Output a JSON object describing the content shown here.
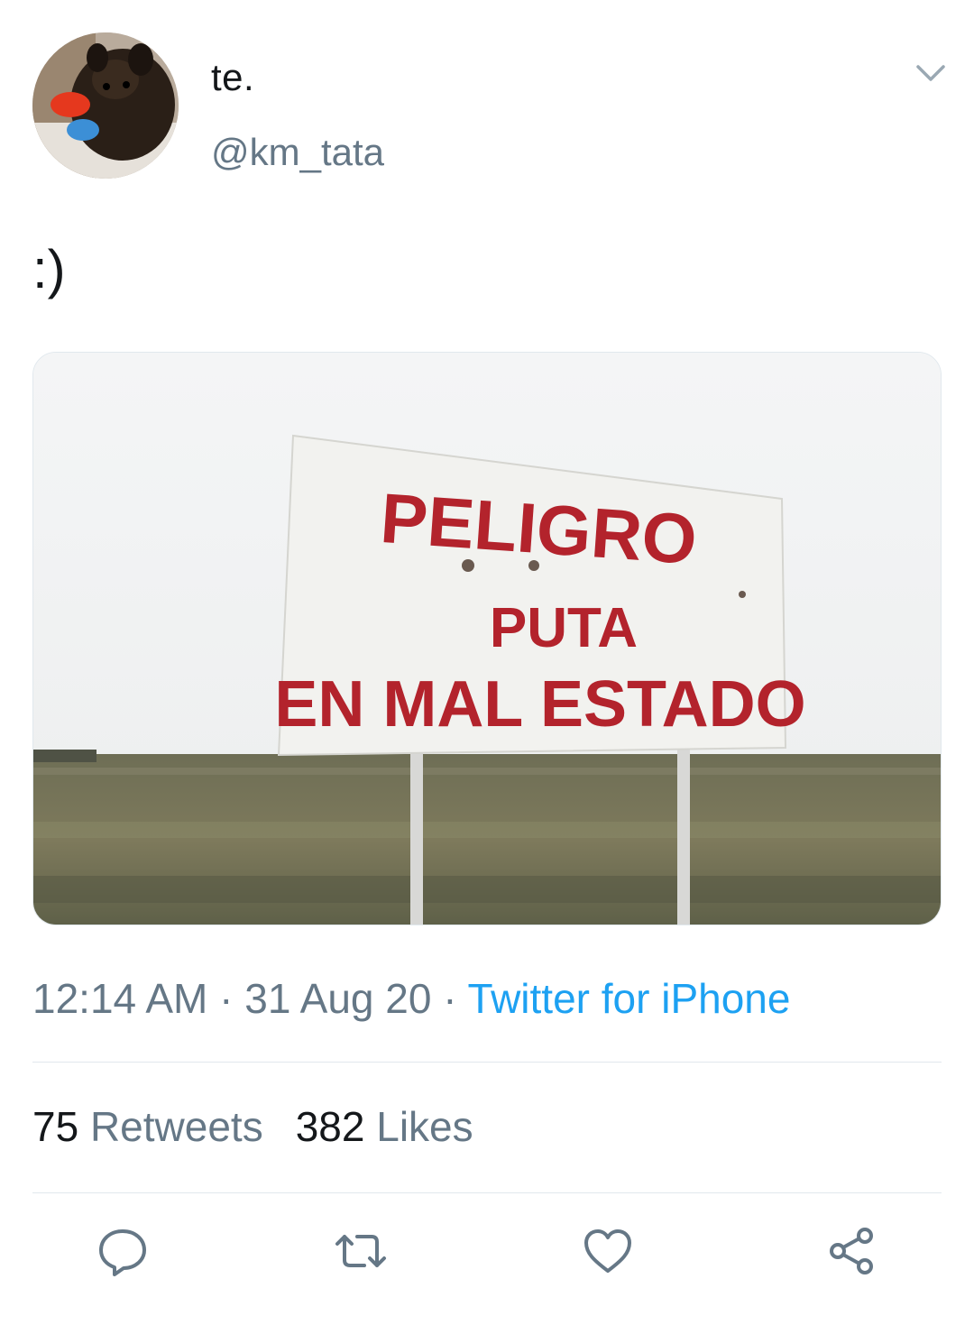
{
  "tweet": {
    "display_name": "te.",
    "handle": "@km_tata",
    "text": ":)",
    "time": "12:14 AM",
    "separator": " · ",
    "date": "31 Aug 20",
    "source": "Twitter for iPhone"
  },
  "media": {
    "sign_line1": "PELIGRO",
    "sign_line2": "PUTA",
    "sign_line3": "EN MAL ESTADO"
  },
  "stats": {
    "retweets_count": "75",
    "retweets_label": " Retweets",
    "likes_count": "382",
    "likes_label": " Likes"
  },
  "icons": {
    "caret": "chevron-down-icon",
    "reply": "reply-icon",
    "retweet": "retweet-icon",
    "like": "heart-icon",
    "share": "share-icon"
  },
  "colors": {
    "text": "#14171a",
    "secondary": "#657786",
    "link": "#1da1f2",
    "divider": "#e1e8ed",
    "sign_letters": "#b3232c"
  }
}
